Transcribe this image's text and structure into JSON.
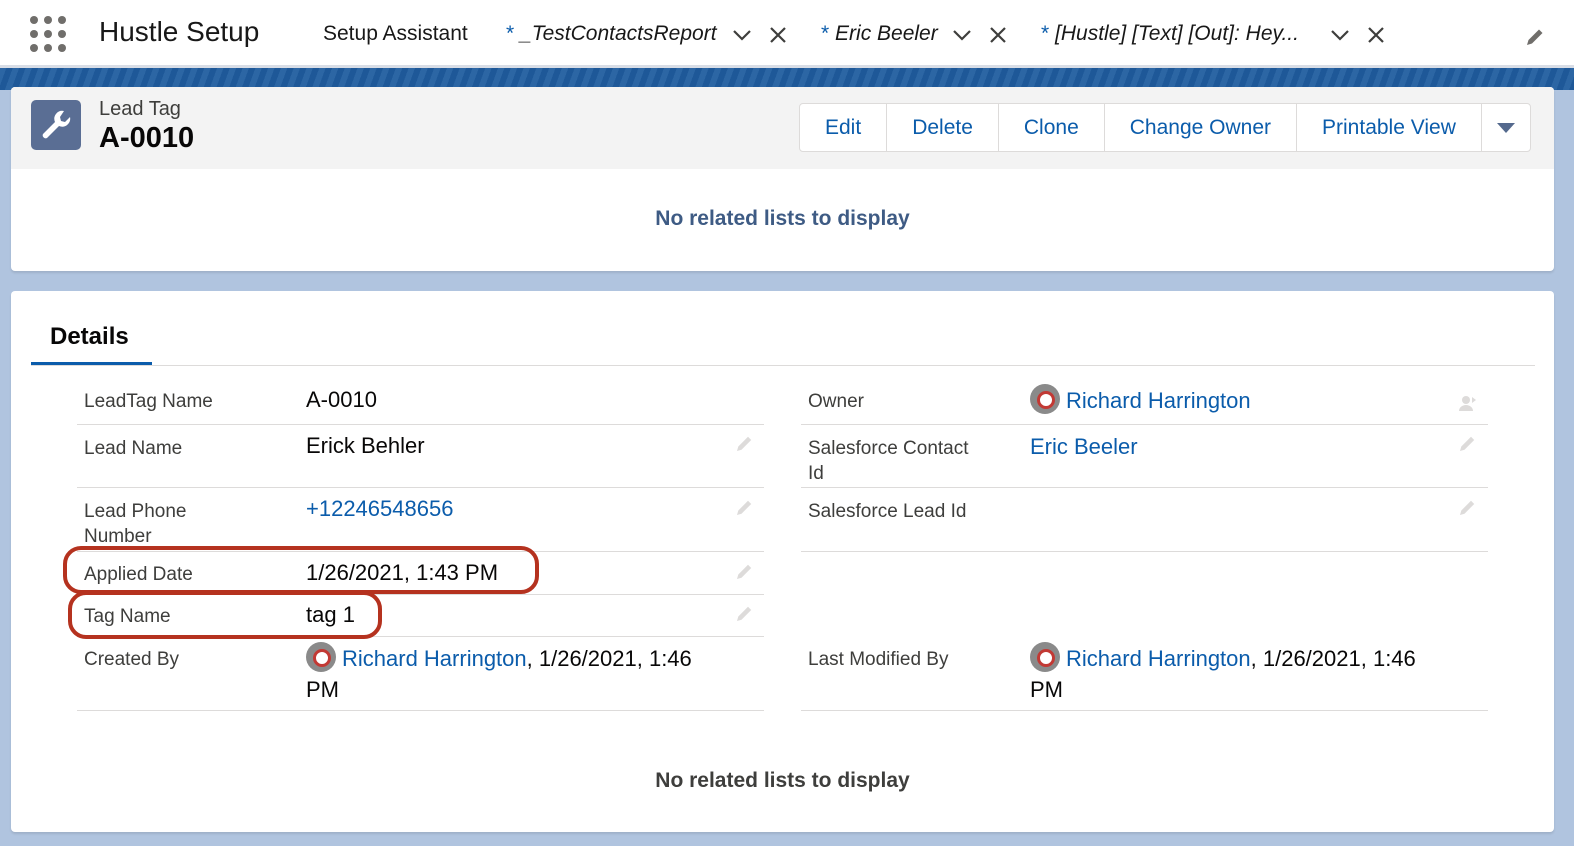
{
  "nav": {
    "app_name": "Hustle Setup",
    "tabs": [
      {
        "label": "Setup Assistant",
        "star": ""
      },
      {
        "label": "_TestContactsReport",
        "star": "*"
      },
      {
        "label": "Eric Beeler",
        "star": "*"
      },
      {
        "label": "[Hustle] [Text] [Out]: Hey...",
        "star": "*"
      }
    ]
  },
  "header": {
    "object_type": "Lead Tag",
    "record_name": "A-0010",
    "buttons": [
      "Edit",
      "Delete",
      "Clone",
      "Change Owner",
      "Printable View"
    ],
    "no_related": "No related lists to display"
  },
  "details": {
    "tab_label": "Details",
    "left": {
      "leadtag_name_label": "LeadTag Name",
      "leadtag_name_value": "A-0010",
      "lead_name_label": "Lead Name",
      "lead_name_value": "Erick Behler",
      "lead_phone_label_1": "Lead Phone",
      "lead_phone_label_2": "Number",
      "lead_phone_value": "+12246548656",
      "applied_date_label": "Applied Date",
      "applied_date_value": "1/26/2021, 1:43 PM",
      "tag_name_label": "Tag Name",
      "tag_name_value": "tag 1",
      "created_by_label": "Created By",
      "created_by_user": "Richard Harrington",
      "created_by_time_1": ", 1/26/2021, 1:46",
      "created_by_time_2": "PM"
    },
    "right": {
      "owner_label": "Owner",
      "owner_value": "Richard Harrington",
      "sf_contact_label_1": "Salesforce Contact",
      "sf_contact_label_2": "Id",
      "sf_contact_value": "Eric Beeler",
      "sf_lead_label": "Salesforce Lead Id",
      "last_modified_label": "Last Modified By",
      "last_modified_user": "Richard Harrington",
      "last_modified_time_1": ", 1/26/2021, 1:46",
      "last_modified_time_2": "PM"
    },
    "no_related": "No related lists to display"
  },
  "colors": {
    "brand_blue": "#0b5cab",
    "annotation_red": "#b5321f",
    "band": "#1f5c9e"
  },
  "icons": [
    "app-launcher-icon",
    "chevron-down-icon",
    "close-icon",
    "pencil-icon",
    "wrench-icon",
    "change-owner-icon",
    "avatar-icon"
  ]
}
